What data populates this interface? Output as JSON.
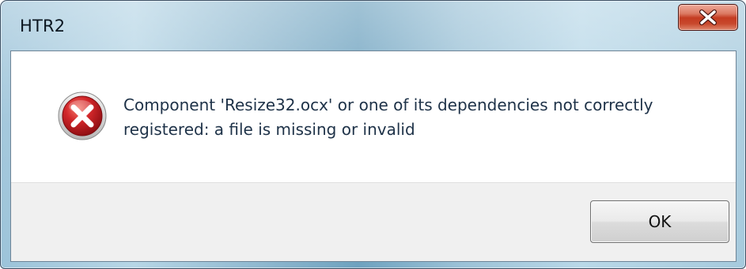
{
  "window": {
    "title": "HTR2",
    "close_symbol": "×"
  },
  "dialog": {
    "icon": "error-icon",
    "message": "Component 'Resize32.ocx' or one of its dependencies not correctly registered: a file is missing or invalid",
    "ok_label": "OK"
  },
  "colors": {
    "error_red": "#c8181a",
    "close_button_red": "#c43c22",
    "message_text": "#1e3248",
    "button_area": "#f0f0f0"
  }
}
